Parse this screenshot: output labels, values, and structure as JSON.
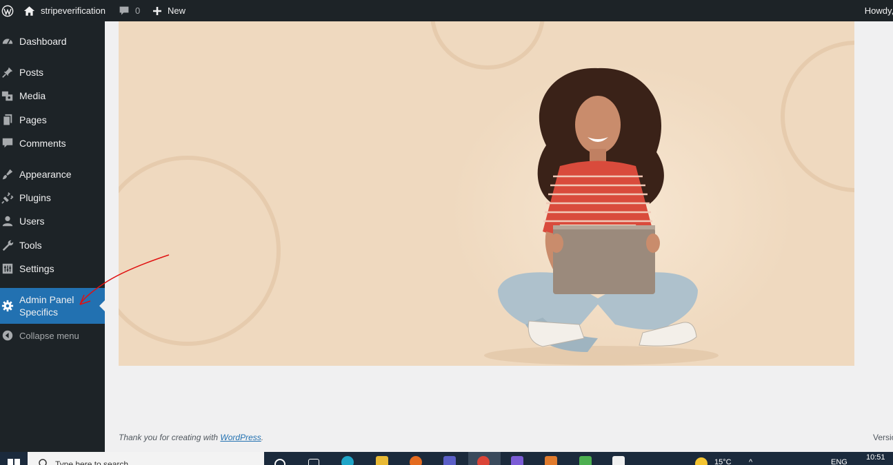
{
  "admin_bar": {
    "site_name": "stripeverification",
    "comments_count": "0",
    "new_label": "New",
    "howdy": "Howdy, a"
  },
  "sidebar": {
    "items": [
      {
        "label": "Dashboard",
        "icon": "dashboard-icon"
      },
      {
        "label": "Posts",
        "icon": "pin-icon"
      },
      {
        "label": "Media",
        "icon": "media-icon"
      },
      {
        "label": "Pages",
        "icon": "pages-icon"
      },
      {
        "label": "Comments",
        "icon": "comment-icon"
      },
      {
        "label": "Appearance",
        "icon": "brush-icon"
      },
      {
        "label": "Plugins",
        "icon": "plug-icon"
      },
      {
        "label": "Users",
        "icon": "user-icon"
      },
      {
        "label": "Tools",
        "icon": "wrench-icon"
      },
      {
        "label": "Settings",
        "icon": "settings-icon"
      },
      {
        "label_line1": "Admin Panel",
        "label_line2": "Specifics",
        "icon": "gear-icon",
        "current": true
      },
      {
        "label": "Collapse menu",
        "icon": "collapse-arrow-icon"
      }
    ]
  },
  "footer": {
    "thanks_prefix": "Thank you for creating with ",
    "wordpress_link": "WordPress",
    "thanks_suffix": ".",
    "version_text": "Versio"
  },
  "taskbar": {
    "search_placeholder": "Type here to search",
    "weather": "15°C",
    "language": "ENG",
    "time": "10:51"
  },
  "colors": {
    "admin_bar_bg": "#1d2327",
    "sidebar_bg": "#1d2327",
    "current_item_bg": "#2271b1",
    "hero_bg": "#efd9bf",
    "annotation_arrow": "#e01010"
  }
}
